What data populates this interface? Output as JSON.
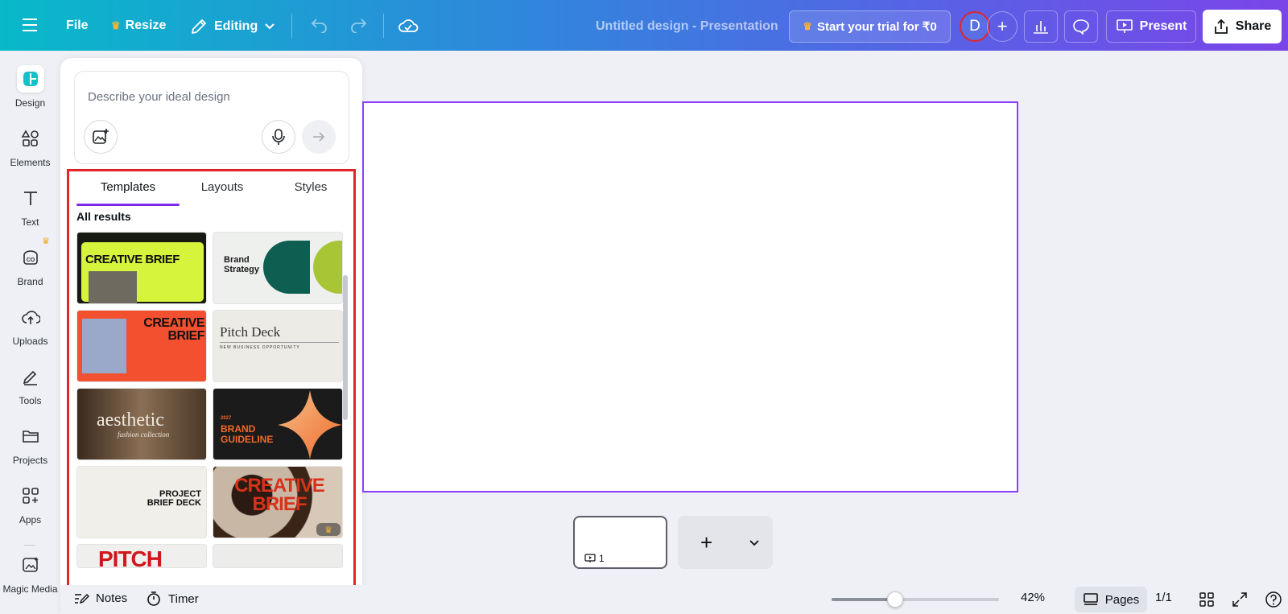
{
  "topbar": {
    "menu_icon": "hamburger-icon",
    "file_label": "File",
    "resize_label": "Resize",
    "editing_label": "Editing",
    "doc_title": "Untitled design - Presentation",
    "trial_label": "Start your trial for ₹0",
    "avatar_letter": "D",
    "present_label": "Present",
    "share_label": "Share"
  },
  "rail": {
    "items": [
      {
        "label": "Design",
        "icon": "design-icon"
      },
      {
        "label": "Elements",
        "icon": "elements-icon"
      },
      {
        "label": "Text",
        "icon": "text-icon"
      },
      {
        "label": "Brand",
        "icon": "brand-icon"
      },
      {
        "label": "Uploads",
        "icon": "uploads-icon"
      },
      {
        "label": "Tools",
        "icon": "tools-icon"
      },
      {
        "label": "Projects",
        "icon": "projects-icon"
      },
      {
        "label": "Apps",
        "icon": "apps-icon"
      },
      {
        "label": "Magic Media",
        "icon": "magic-media-icon"
      }
    ]
  },
  "panel": {
    "prompt_placeholder": "Describe your ideal design",
    "tabs": [
      "Templates",
      "Layouts",
      "Styles"
    ],
    "active_tab": "Templates",
    "results_heading": "All results",
    "templates": [
      {
        "title": "CREATIVE BRIEF",
        "style": "lime-dark"
      },
      {
        "title": "Brand Strategy",
        "style": "green-shapes"
      },
      {
        "title": "CREATIVE BRIEF",
        "style": "red-orange"
      },
      {
        "title": "Pitch Deck",
        "style": "cream-serif",
        "subtitle": "NEW BUSINESS OPPORTUNITY"
      },
      {
        "title": "aesthetic",
        "style": "fashion-photo",
        "subtitle": "fashion collection"
      },
      {
        "title": "BRAND GUIDELINE",
        "style": "dark-orange",
        "year": "2027"
      },
      {
        "title": "PROJECT BRIEF DECK",
        "style": "cream-minimal"
      },
      {
        "title": "CREATIVE BRIEF",
        "style": "cow-print-red",
        "premium": true
      },
      {
        "title": "PITCH",
        "style": "red-pitch"
      },
      {
        "title": "",
        "style": "light-plain"
      }
    ]
  },
  "pages": {
    "page_number": "1",
    "notes_label": "Notes",
    "timer_label": "Timer",
    "zoom_percent": "42%",
    "zoom_fraction": 0.42,
    "pages_label": "Pages",
    "page_count": "1/1"
  }
}
